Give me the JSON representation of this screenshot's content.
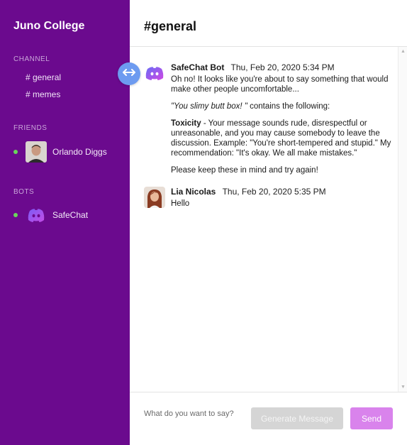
{
  "sidebar": {
    "workspace_title": "Juno College",
    "channels_heading": "CHANNEL",
    "channels": [
      {
        "label": "# general"
      },
      {
        "label": "# memes"
      }
    ],
    "friends_heading": "FRIENDS",
    "friends": [
      {
        "name": "Orlando Diggs",
        "status": "online"
      }
    ],
    "bots_heading": "BOTS",
    "bots": [
      {
        "name": "SafeChat",
        "status": "online"
      }
    ]
  },
  "channel": {
    "title": "#general"
  },
  "messages": [
    {
      "author": "SafeChat Bot",
      "time": "Thu, Feb 20, 2020 5:34 PM",
      "intro": "Oh no! It looks like you're about to say something that would make other people uncomfortable...",
      "quote": "\"You slimy butt box! \"",
      "quote_suffix": "contains the following:",
      "category": "Toxicity",
      "category_text": "- Your message sounds rude, disrespectful or unreasonable, and you may cause somebody to leave the discussion. Example: \"You're short-tempered and stupid.\" My recommendation: \"It's okay. We all make mistakes.\"",
      "closing": "Please keep these in mind and try again!"
    },
    {
      "author": "Lia Nicolas",
      "time": "Thu, Feb 20, 2020 5:35 PM",
      "text": "Hello"
    }
  ],
  "composer": {
    "placeholder": "What do you want to say?",
    "generate_label": "Generate Message",
    "send_label": "Send"
  },
  "colors": {
    "sidebar_bg": "#6b0a8e",
    "online": "#6ad65b",
    "send_button": "#d983ec",
    "generate_button": "#d5d5d5",
    "toggle_button": "#6d9bf0"
  }
}
